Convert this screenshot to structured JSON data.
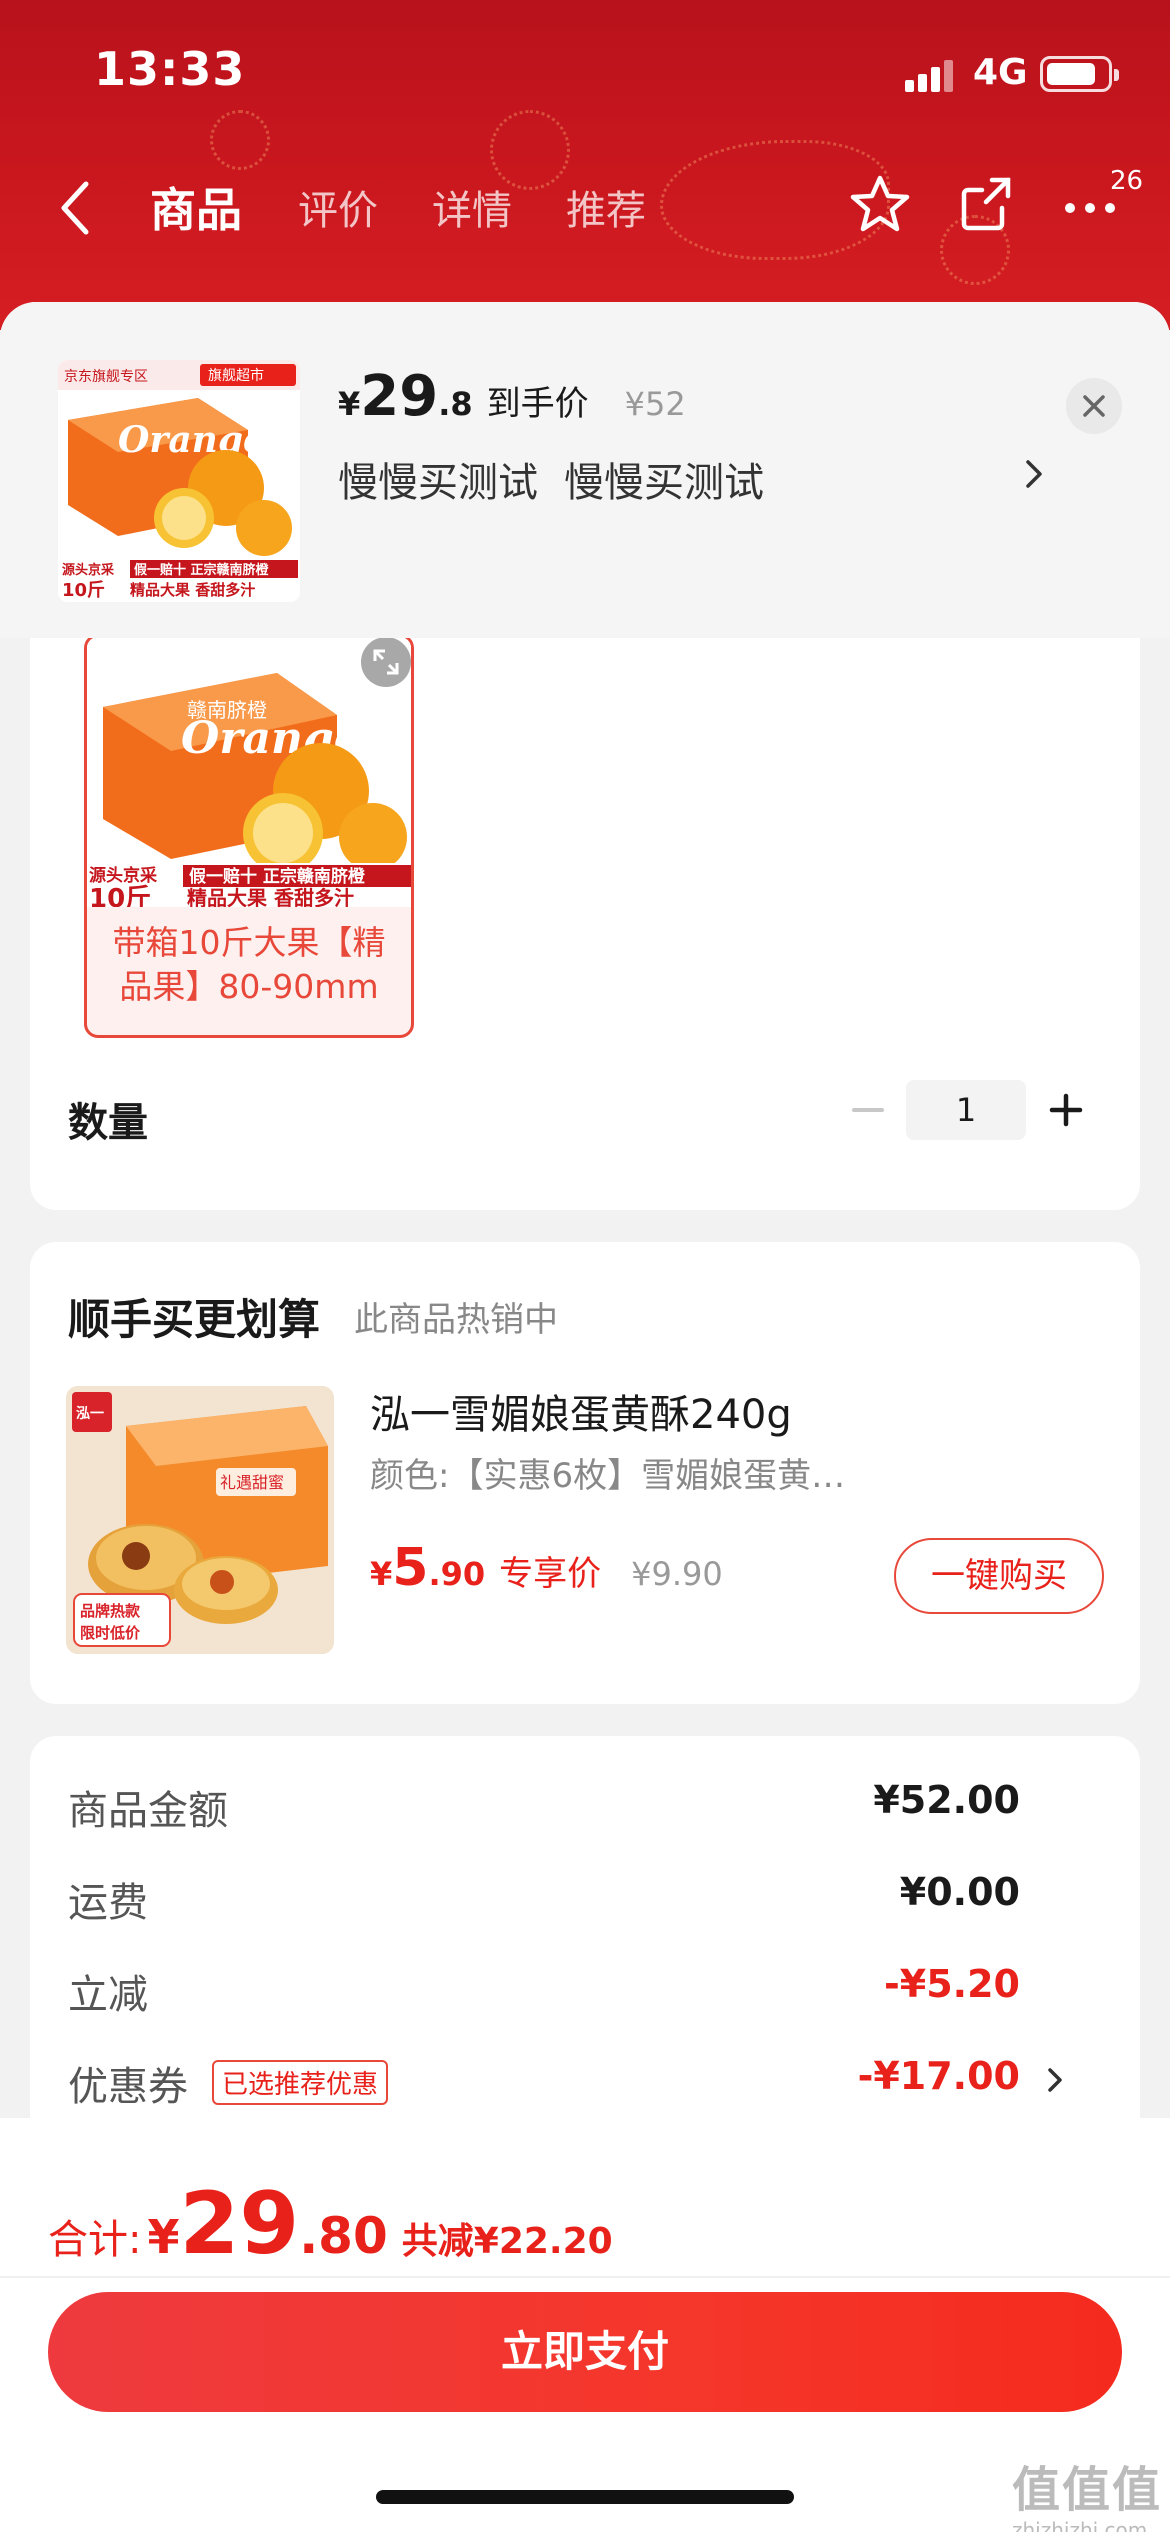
{
  "status": {
    "time": "13:33",
    "network": "4G"
  },
  "nav": {
    "tabs": [
      "商品",
      "评价",
      "详情",
      "推荐"
    ],
    "badge": "26",
    "icons": [
      "back-icon",
      "favorite-star-icon",
      "share-icon",
      "more-icon"
    ]
  },
  "product": {
    "currency": "¥",
    "price_int": "29",
    "price_dec": ".8",
    "price_label": "到手价",
    "original_price": "¥52",
    "spec_a": "慢慢买测试",
    "spec_b": "慢慢买测试",
    "thumb_badge_left": "京东旗舰专区",
    "thumb_badge_right": "旗舰超市",
    "thumb_brand": "Orange",
    "thumb_line1": "假一赔十 正宗赣南脐橙",
    "thumb_line2_a": "源头京采",
    "thumb_line2_b": "10斤",
    "thumb_line2_c": "精品大果 香甜多汁"
  },
  "spec_option": {
    "label": "带箱10斤大果【精品果】80-90mm",
    "img_line1": "假一赔十 正宗赣南脐橙",
    "img_line2_a": "源头京采",
    "img_line2_b": "10斤",
    "img_line2_c": "精品大果 香甜多汁"
  },
  "quantity": {
    "label": "数量",
    "value": "1"
  },
  "upsell": {
    "title": "顺手买更划算",
    "subtitle": "此商品热销中",
    "name": "泓一雪媚娘蛋黄酥240g",
    "spec": "颜色:【实惠6枚】雪媚娘蛋黄…",
    "currency": "¥",
    "price_int": "5",
    "price_dec": ".90",
    "price_label": "专享价",
    "original_price": "¥9.90",
    "buy_label": "一键购买",
    "img_brand": "泓一",
    "img_title": "礼遇甜蜜",
    "img_tag_1": "品牌热款",
    "img_tag_2": "限时低价"
  },
  "fees": [
    {
      "label": "商品金额",
      "value": "¥52.00"
    },
    {
      "label": "运费",
      "value": "¥0.00"
    },
    {
      "label": "立减",
      "value": "-¥5.20"
    },
    {
      "label": "优惠券",
      "tag": "已选推荐优惠",
      "value": "-¥17.00"
    }
  ],
  "footer": {
    "total_label": "合计:",
    "currency": "¥",
    "total_int": "29",
    "total_dec": ".80",
    "saving": "共减¥22.20",
    "pay_label": "立即支付",
    "watermark": "值值值",
    "watermark_url": "zhizhizhi.com"
  },
  "colors": {
    "accent_red": "#e8211b",
    "header_red": "#c8161e"
  }
}
